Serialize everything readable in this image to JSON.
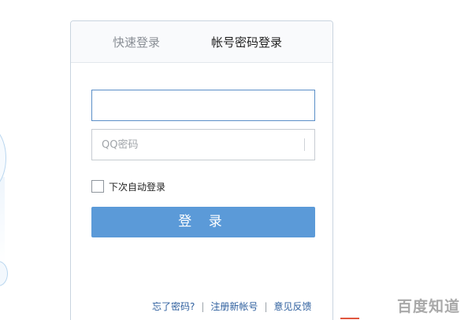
{
  "tabs": {
    "quick_login": "快速登录",
    "account_login": "帐号密码登录"
  },
  "form": {
    "account_value": "",
    "password_placeholder": "QQ密码",
    "remember_label": "下次自动登录",
    "login_button": "登 录"
  },
  "footer_links": {
    "forgot_password": "忘了密码?",
    "register": "注册新帐号",
    "feedback": "意见反馈",
    "separator": "|"
  },
  "watermark": "百度知道",
  "colors": {
    "accent": "#5b9ad8",
    "link": "#2e5f9e",
    "focus_border": "#5b8fc7"
  }
}
